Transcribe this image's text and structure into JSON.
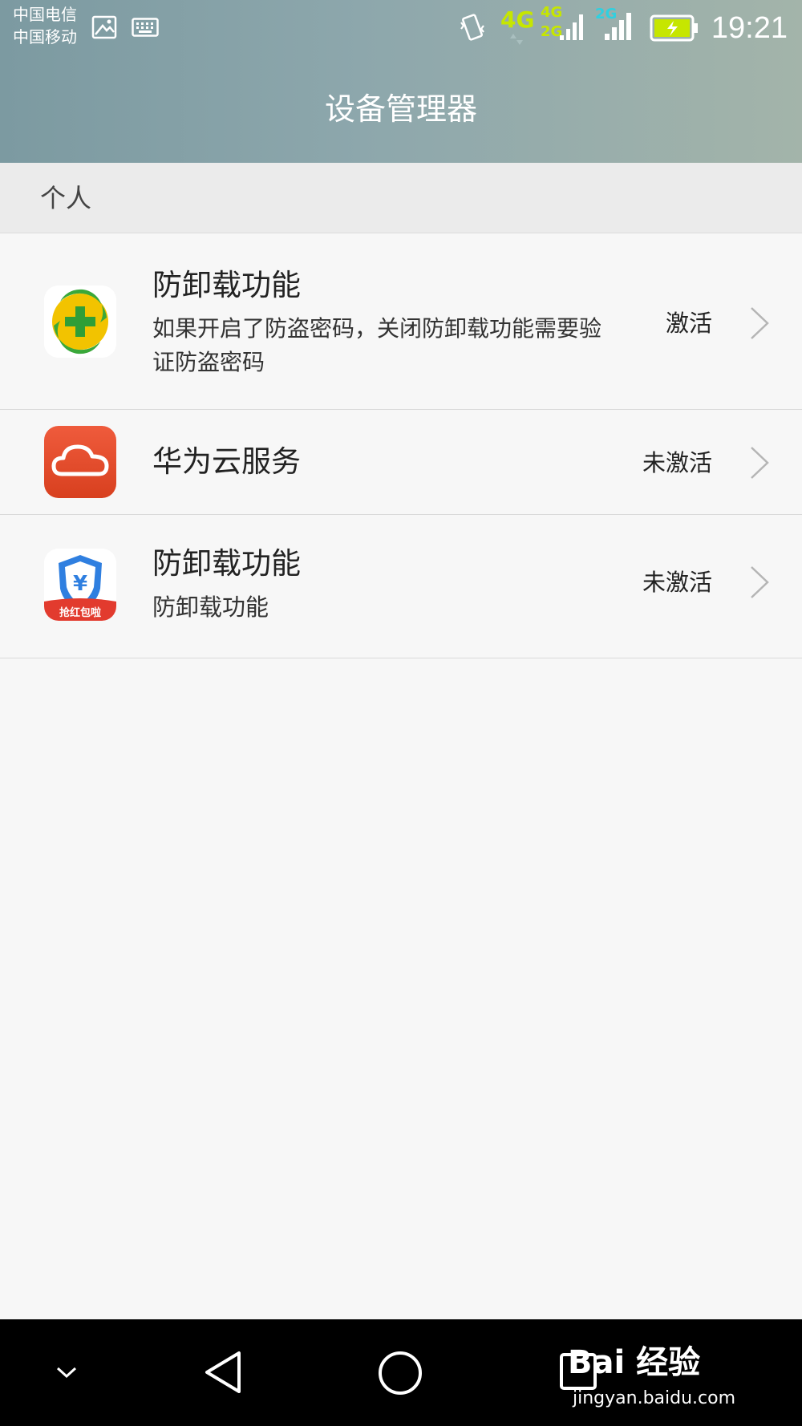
{
  "status_bar": {
    "carrier_1": "中国电信",
    "carrier_2": "中国移动",
    "network_1": "4G",
    "network_2a": "4G",
    "network_2b": "2G",
    "network_3": "2G",
    "time": "19:21",
    "icons": [
      "image-icon",
      "keyboard-icon",
      "vibrate-icon",
      "signal-icon",
      "battery-charging-icon"
    ]
  },
  "header": {
    "title": "设备管理器"
  },
  "section": {
    "label": "个人"
  },
  "items": [
    {
      "title": "防卸载功能",
      "subtitle": "如果开启了防盗密码，关闭防卸载功能需要验证防盗密码",
      "status": "激活",
      "icon": "360-security-icon"
    },
    {
      "title": "华为云服务",
      "status": "未激活",
      "icon": "huawei-cloud-icon"
    },
    {
      "title": "防卸载功能",
      "subtitle": "防卸载功能",
      "status": "未激活",
      "icon": "shield-yen-icon",
      "icon_text": "抢红包啦"
    }
  ],
  "nav": {
    "buttons": [
      "collapse-icon",
      "back-icon",
      "home-icon",
      "recents-icon"
    ]
  },
  "watermark": {
    "main": "Bai 经验",
    "sub": "jingyan.baidu.com"
  }
}
